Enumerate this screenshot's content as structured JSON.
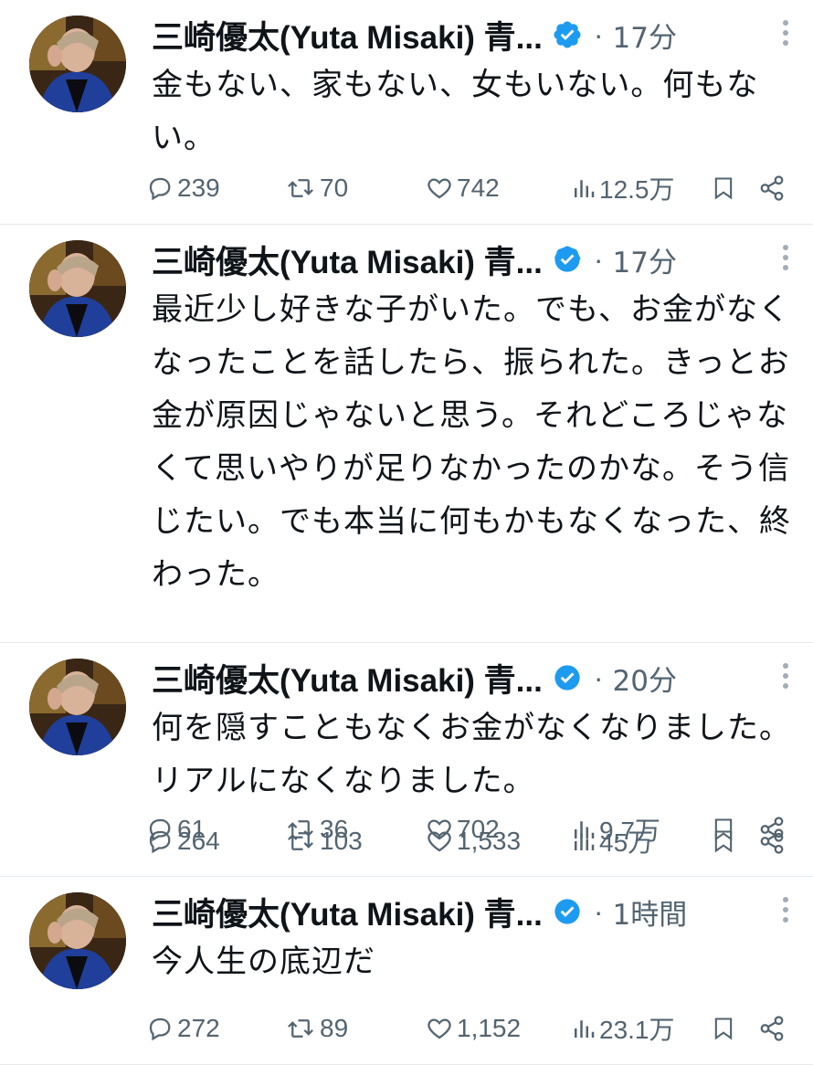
{
  "colors": {
    "text_primary": "#0f1419",
    "text_secondary": "#536471",
    "verified_blue": "#1d9bf0",
    "divider": "#e6e9ec"
  },
  "tweets": [
    {
      "author": "三崎優太(Yuta Misaki) 青...",
      "time": "17分",
      "separator": "·",
      "text": "金もない、家もない、女もいない。何もない。",
      "replies": "239",
      "retweets": "70",
      "likes": "742",
      "views": "12.5万"
    },
    {
      "author": "三崎優太(Yuta Misaki) 青...",
      "time": "17分",
      "separator": "·",
      "text": "最近少し好きな子がいた。でも、お金がなくなったことを話したら、振られた。きっとお金が原因じゃないと思う。それどころじゃなくて思いやりが足りなかったのかな。そう信じたい。でも本当に何もかもなくなった、終わった。",
      "replies": "61",
      "retweets": "36",
      "likes": "702",
      "views": "9.7万"
    },
    {
      "author": "三崎優太(Yuta Misaki) 青...",
      "time": "20分",
      "separator": "·",
      "text": "何を隠すこともなくお金がなくなりました。リアルになくなりました。",
      "replies": "264",
      "retweets": "103",
      "likes": "1,533",
      "views": "45万"
    },
    {
      "author": "三崎優太(Yuta Misaki) 青...",
      "time": "1時間",
      "separator": "·",
      "text": "今人生の底辺だ",
      "replies": "272",
      "retweets": "89",
      "likes": "1,152",
      "views": "23.1万"
    }
  ]
}
